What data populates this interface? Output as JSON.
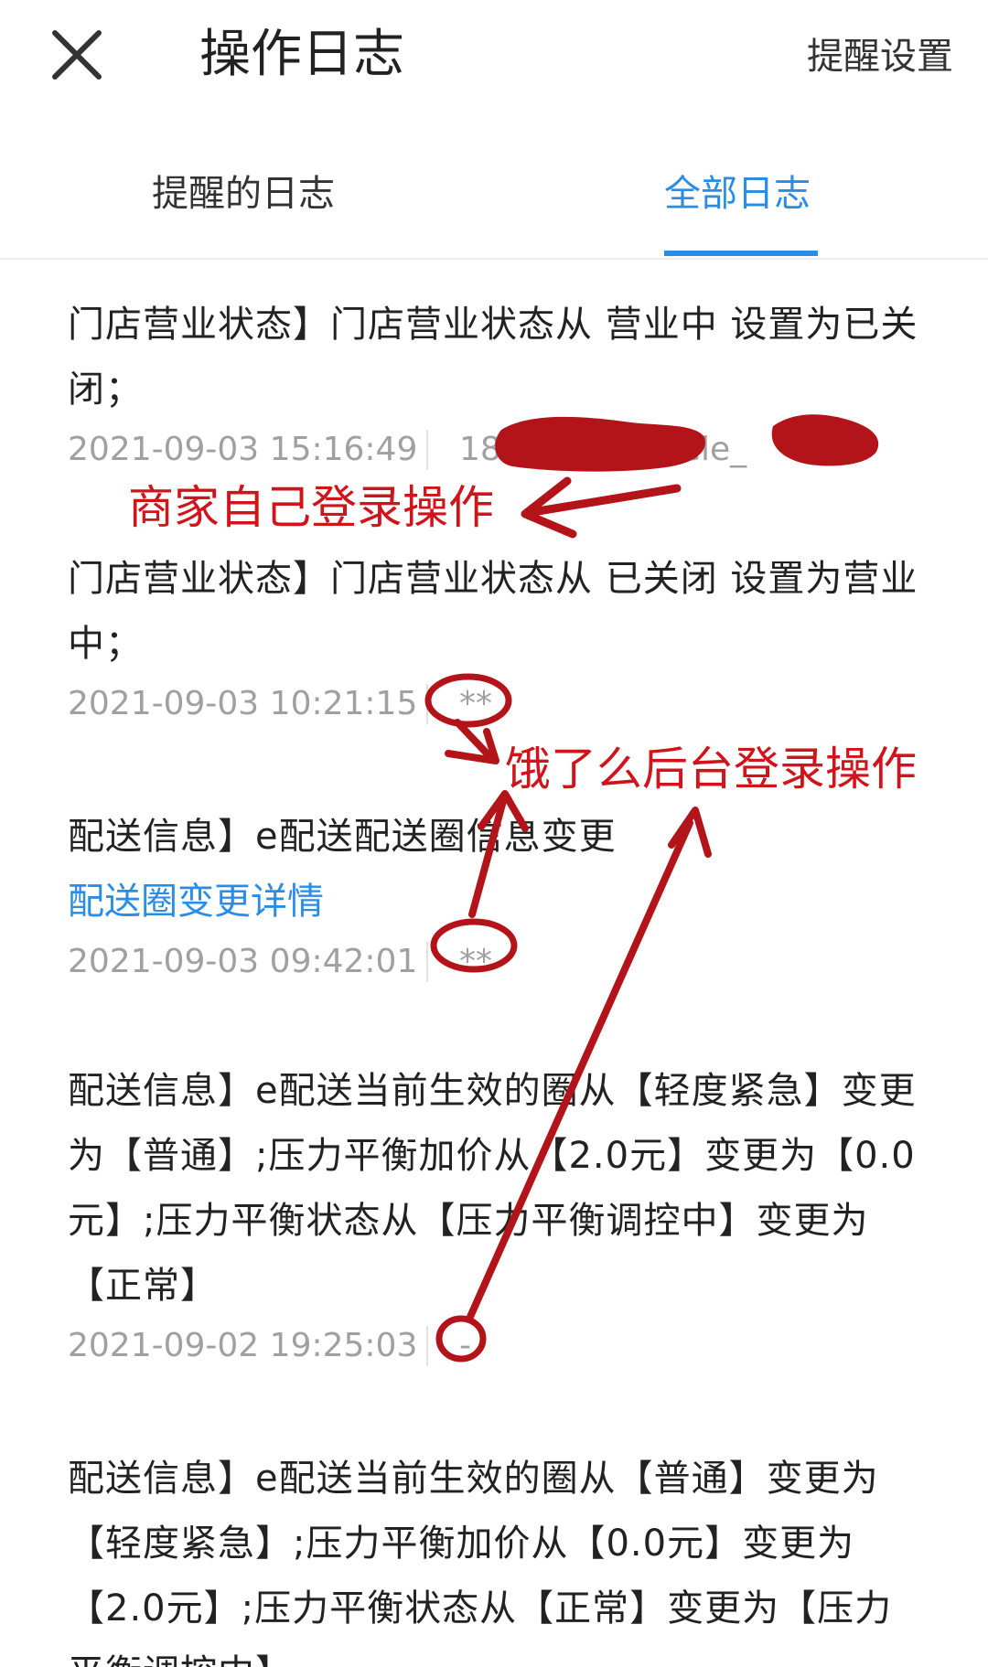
{
  "header": {
    "title": "操作日志",
    "settings_label": "提醒设置"
  },
  "tabs": [
    {
      "label": "提醒的日志",
      "active": false
    },
    {
      "label": "全部日志",
      "active": true
    }
  ],
  "logs": [
    {
      "text": "门店营业状态】门店营业状态从 营业中 设置为已关闭；",
      "link": "",
      "time": "2021-09-03 15:16:49",
      "operator": "18",
      "operator_tail": "ele_"
    },
    {
      "text": "门店营业状态】门店营业状态从 已关闭 设置为营业中；",
      "link": "",
      "time": "2021-09-03 10:21:15",
      "operator": "**"
    },
    {
      "text": "配送信息】e配送配送圈信息变更",
      "link": "配送圈变更详情",
      "time": "2021-09-03 09:42:01",
      "operator": "**"
    },
    {
      "text": "配送信息】e配送当前生效的圈从【轻度紧急】变更为【普通】;压力平衡加价从【2.0元】变更为【0.0元】;压力平衡状态从【压力平衡调控中】变更为【正常】",
      "link": "",
      "time": "2021-09-02 19:25:03",
      "operator": "-"
    },
    {
      "text": "配送信息】e配送当前生效的圈从【普通】变更为【轻度紧急】;压力平衡加价从【0.0元】变更为【2.0元】;压力平衡状态从【正常】变更为【压力平衡调控中】",
      "link": "",
      "time": "",
      "operator": ""
    }
  ],
  "annotations": {
    "merchant_label": "商家自己登录操作",
    "backend_label": "饿了么后台登录操作",
    "color": "#d0141b"
  },
  "colors": {
    "accent": "#2b8ce6",
    "meta_text": "#a0a0a0",
    "annotation": "#d0141b"
  }
}
